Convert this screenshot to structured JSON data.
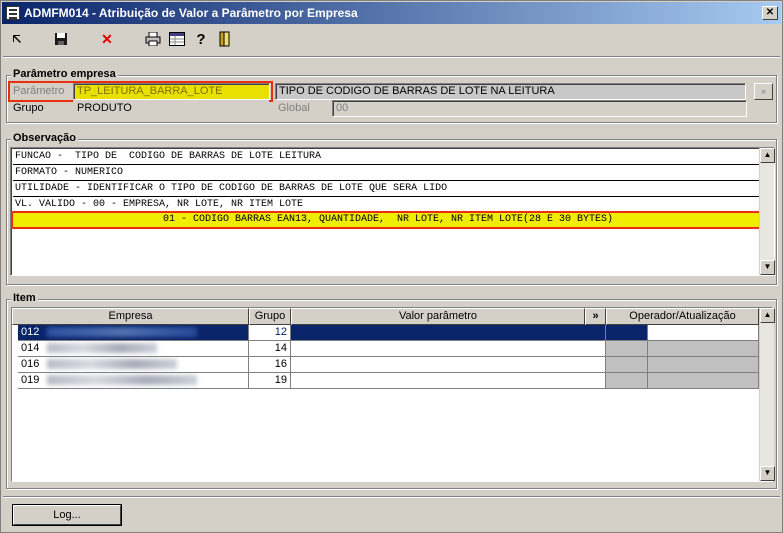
{
  "window": {
    "title": "ADMFM014 - Atribuição de Valor a Parâmetro por Empresa",
    "close_label": "✕"
  },
  "toolbar": {
    "icons": [
      "back-icon",
      "save-icon",
      "delete-icon",
      "print-icon",
      "grid-icon",
      "help-icon",
      "exit-icon"
    ]
  },
  "parametro_empresa": {
    "group_label": "Parâmetro empresa",
    "parametro_label": "Parâmetro",
    "parametro_value": "TP_LEITURA_BARRA_LOTE",
    "descricao_value": "TIPO DE  CODIGO DE BARRAS DE LOTE NA LEITURA",
    "grupo_label": "Grupo",
    "grupo_value": "PRODUTO",
    "global_label": "Global",
    "global_value": "00",
    "expand_label": "»"
  },
  "observacao": {
    "group_label": "Observação",
    "lines": [
      "FUNCAO -  TIPO DE  CODIGO DE BARRAS DE LOTE LEITURA",
      "FORMATO - NUMERICO",
      "UTILIDADE - IDENTIFICAR O TIPO DE CODIGO DE BARRAS DE LOTE QUE SERA LIDO",
      "VL. VALIDO - 00 - EMPRESA, NR LOTE, NR ITEM LOTE",
      "01 - CODIGO BARRAS EAN13, QUANTIDADE,  NR LOTE, NR ITEM LOTE(28 E 30 BYTES)"
    ]
  },
  "item": {
    "group_label": "Item",
    "columns": [
      "Empresa",
      "Grupo",
      "Valor parâmetro",
      "»",
      "Operador/Atualização"
    ],
    "rows": [
      {
        "empresa": "012",
        "grupo": "12",
        "valor": ""
      },
      {
        "empresa": "014",
        "grupo": "14",
        "valor": ""
      },
      {
        "empresa": "016",
        "grupo": "16",
        "valor": ""
      },
      {
        "empresa": "019",
        "grupo": "19",
        "valor": ""
      }
    ]
  },
  "footer": {
    "log_button": "Log..."
  },
  "colors": {
    "titlebar": "#0a246a",
    "highlight": "#f0ec00",
    "annotation": "#e83010"
  }
}
